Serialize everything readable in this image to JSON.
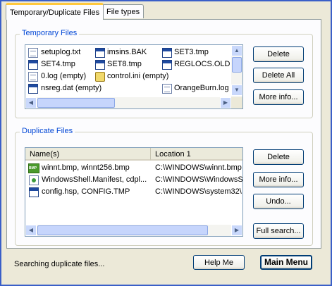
{
  "tabs": [
    {
      "label": "Temporary/Duplicate Files",
      "active": true
    },
    {
      "label": "File types",
      "active": false
    }
  ],
  "temporary": {
    "legend": "Temporary Files",
    "files": [
      {
        "name": "setuplog.txt",
        "icon": "text-file-icon"
      },
      {
        "name": "imsins.BAK",
        "icon": "tmp-file-icon"
      },
      {
        "name": "SET3.tmp",
        "icon": "tmp-file-icon"
      },
      {
        "name": "SET4.tmp",
        "icon": "tmp-file-icon"
      },
      {
        "name": "SET8.tmp",
        "icon": "tmp-file-icon"
      },
      {
        "name": "REGLOCS.OLD",
        "icon": "tmp-file-icon"
      },
      {
        "name": "0.log (empty)",
        "icon": "text-file-icon"
      },
      {
        "name": "control.ini (empty)",
        "icon": "ini-file-icon"
      },
      {
        "name": "nsreg.dat (empty)",
        "icon": "tmp-file-icon"
      },
      {
        "name": "OrangeBurn.log (",
        "icon": "text-file-icon"
      }
    ],
    "buttons": {
      "delete": "Delete",
      "delete_all": "Delete All",
      "more_info": "More info..."
    }
  },
  "duplicate": {
    "legend": "Duplicate Files",
    "columns": {
      "name": "Name(s)",
      "location": "Location 1"
    },
    "rows": [
      {
        "name": "winnt.bmp, winnt256.bmp",
        "location": "C:\\WINDOWS\\winnt.bmp",
        "icon": "bmp-file-icon"
      },
      {
        "name": "WindowsShell.Manifest, cdpl...",
        "location": "C:\\WINDOWS\\WindowsS",
        "icon": "manifest-file-icon"
      },
      {
        "name": "config.hsp, CONFIG.TMP",
        "location": "C:\\WINDOWS\\system32\\",
        "icon": "tmp-file-icon"
      }
    ],
    "buttons": {
      "delete": "Delete",
      "more_info": "More info...",
      "undo": "Undo...",
      "full_search": "Full search..."
    }
  },
  "footer": {
    "status": "Searching duplicate files...",
    "help": "Help Me",
    "main_menu": "Main Menu"
  }
}
